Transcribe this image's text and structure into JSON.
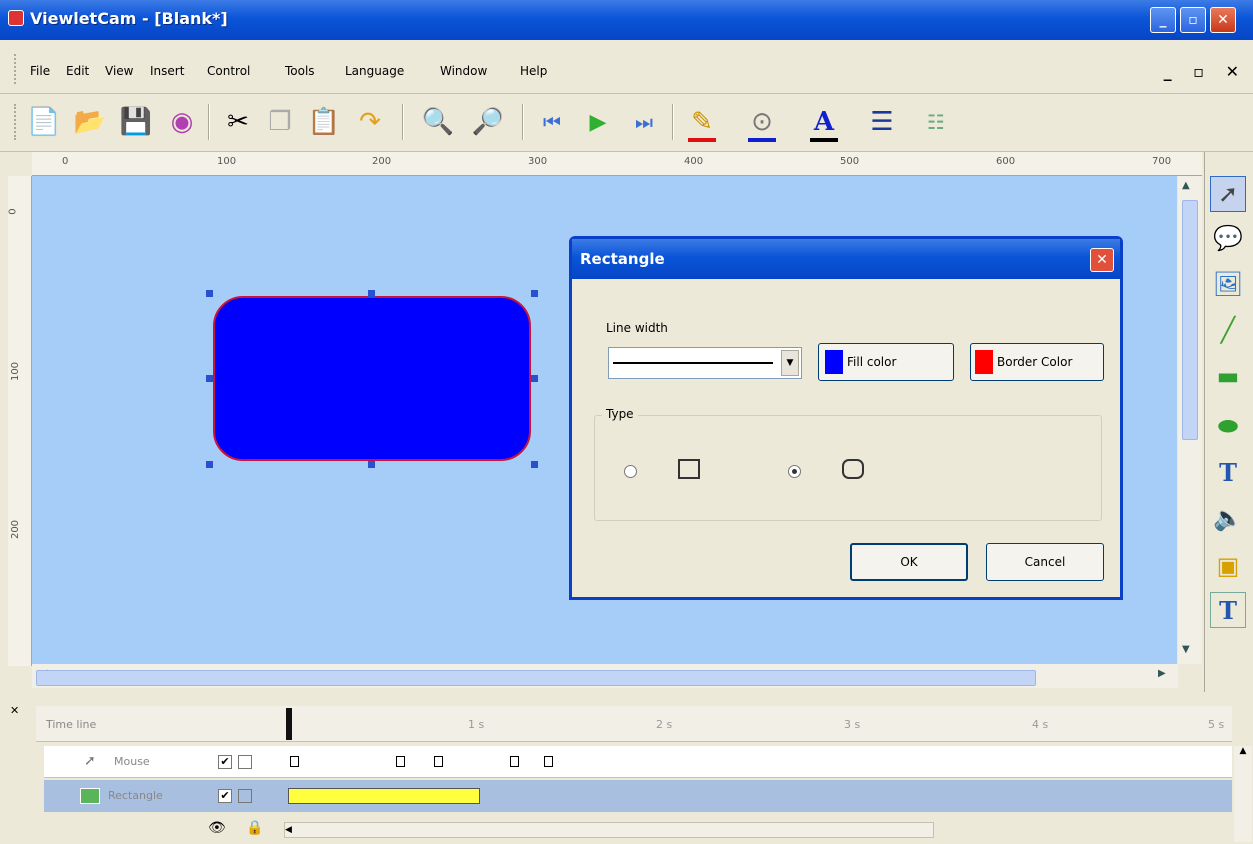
{
  "window": {
    "title": "ViewletCam - [Blank*]",
    "controls": [
      "_",
      "▫",
      "✕"
    ]
  },
  "menu": {
    "items": [
      "File",
      "Edit",
      "View",
      "Insert",
      "Control",
      "Tools",
      "Language",
      "Window",
      "Help"
    ],
    "mdi_controls": "_ ▫ ✕"
  },
  "toolbar": {
    "tools": [
      "new-icon",
      "open-icon",
      "save-icon",
      "record-icon",
      "cut-icon",
      "copy-icon",
      "paste-icon",
      "undo-icon",
      "zoom-in-icon",
      "zoom-out-icon",
      "first-frame-icon",
      "play-icon",
      "last-frame-icon",
      "line-color-icon",
      "fill-color-icon",
      "font-color-icon",
      "line-style-icon",
      "properties-icon"
    ],
    "line_color": "#e01010",
    "fill_color": "#1020d0",
    "font_color": "#000000"
  },
  "ruler": {
    "horizontal": [
      "0",
      "100",
      "200",
      "300",
      "400",
      "500",
      "600",
      "700"
    ],
    "vertical": [
      "0",
      "100",
      "200"
    ]
  },
  "canvas": {
    "background": "#a6ccf8",
    "shape": {
      "fill": "#0000ff",
      "border": "#c8143c",
      "type": "rounded-rectangle"
    }
  },
  "dialog": {
    "title": "Rectangle",
    "line_width_label": "Line width",
    "fill_color_label": "Fill color",
    "fill_color": "#0000ff",
    "border_color_label": "Border Color",
    "border_color": "#ff0000",
    "type_label": "Type",
    "type_selected": "rounded",
    "ok_label": "OK",
    "cancel_label": "Cancel"
  },
  "palette": {
    "tools": [
      "select-arrow-icon",
      "callout-icon",
      "image-icon",
      "line-icon",
      "rectangle-icon",
      "ellipse-icon",
      "text-icon",
      "sound-icon",
      "picture-icon",
      "textbox-icon"
    ]
  },
  "timeline": {
    "header": "Time line",
    "markers": [
      "1 s",
      "2 s",
      "3 s",
      "4 s",
      "5 s"
    ],
    "rows": [
      {
        "name": "Mouse",
        "visible": "✔"
      },
      {
        "name": "Rectangle",
        "visible": "✔"
      }
    ]
  }
}
